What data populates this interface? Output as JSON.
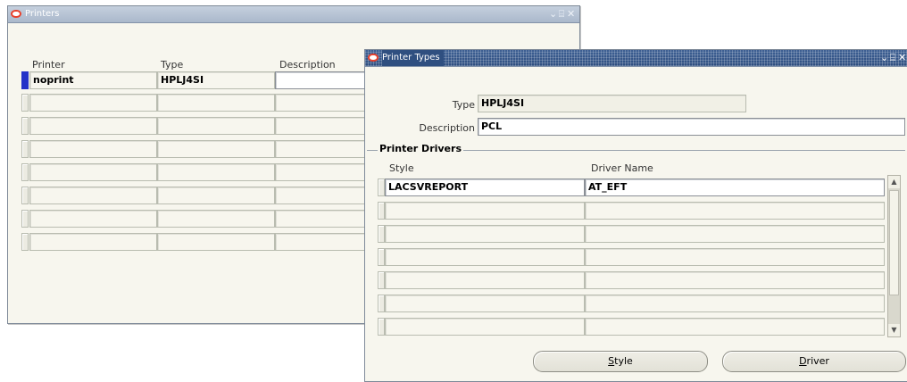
{
  "printers_window": {
    "title": "Printers",
    "columns": {
      "printer": "Printer",
      "type": "Type",
      "description": "Description"
    },
    "rows": [
      {
        "printer": "noprint",
        "type": "HPLJ4SI",
        "description": ""
      },
      {
        "printer": "",
        "type": "",
        "description": ""
      },
      {
        "printer": "",
        "type": "",
        "description": ""
      },
      {
        "printer": "",
        "type": "",
        "description": ""
      },
      {
        "printer": "",
        "type": "",
        "description": ""
      },
      {
        "printer": "",
        "type": "",
        "description": ""
      },
      {
        "printer": "",
        "type": "",
        "description": ""
      },
      {
        "printer": "",
        "type": "",
        "description": ""
      }
    ]
  },
  "printer_types_window": {
    "title": "Printer Types",
    "type_label": "Type",
    "type_value": "HPLJ4SI",
    "description_label": "Description",
    "description_value": "PCL",
    "group_title": "Printer Drivers",
    "columns": {
      "style": "Style",
      "driver_name": "Driver Name"
    },
    "rows": [
      {
        "style": "LACSVREPORT",
        "driver_name": "AT_EFT"
      },
      {
        "style": "",
        "driver_name": ""
      },
      {
        "style": "",
        "driver_name": ""
      },
      {
        "style": "",
        "driver_name": ""
      },
      {
        "style": "",
        "driver_name": ""
      },
      {
        "style": "",
        "driver_name": ""
      },
      {
        "style": "",
        "driver_name": ""
      }
    ],
    "buttons": {
      "style": {
        "mnemonic": "S",
        "rest": "tyle"
      },
      "driver": {
        "mnemonic": "D",
        "rest": "river"
      }
    }
  },
  "window_controls": {
    "minimize": "⌄",
    "maximize": "⌸",
    "close": "✕"
  },
  "colors": {
    "active_title": "#2f4f80",
    "inactive_title": "#b3c0d2",
    "current_record": "#2432c8",
    "canvas": "#f7f6ee"
  }
}
